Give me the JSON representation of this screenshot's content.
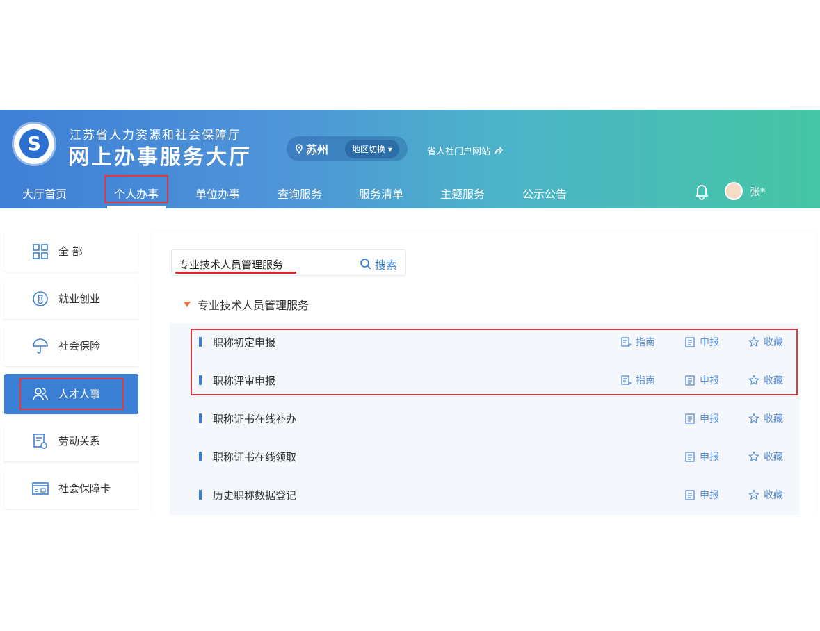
{
  "header": {
    "org_sub": "江苏省人力资源和社会保障厅",
    "org_title": "网上办事服务大厅",
    "logo_letter": "S",
    "city": "苏州",
    "region_switch": "地区切换",
    "portal_link": "省人社门户网站",
    "username": "张*"
  },
  "nav": {
    "items": [
      "大厅首页",
      "个人办事",
      "单位办事",
      "查询服务",
      "服务清单",
      "主题服务",
      "公示公告"
    ],
    "active": "个人办事"
  },
  "sidebar": {
    "items": [
      {
        "label": "全 部",
        "icon": "grid-icon"
      },
      {
        "label": "就业创业",
        "icon": "badge-icon"
      },
      {
        "label": "社会保险",
        "icon": "umbrella-icon"
      },
      {
        "label": "人才人事",
        "icon": "people-icon",
        "active": true
      },
      {
        "label": "劳动关系",
        "icon": "document-icon"
      },
      {
        "label": "社会保障卡",
        "icon": "card-icon"
      }
    ]
  },
  "search": {
    "value": "专业技术人员管理服务",
    "button_label": "搜索"
  },
  "category": {
    "title": "专业技术人员管理服务"
  },
  "actions": {
    "guide": "指南",
    "apply": "申报",
    "favorite": "收藏"
  },
  "services": [
    {
      "name": "职称初定申报",
      "has_guide": true
    },
    {
      "name": "职称评审申报",
      "has_guide": true
    },
    {
      "name": "职称证书在线补办",
      "has_guide": false
    },
    {
      "name": "职称证书在线领取",
      "has_guide": false
    },
    {
      "name": "历史职称数据登记",
      "has_guide": false
    }
  ],
  "colors": {
    "primary": "#3b7fd4",
    "highlight_red": "#e0393e",
    "header_start": "#3f7fd6",
    "header_end": "#46c6a4"
  }
}
